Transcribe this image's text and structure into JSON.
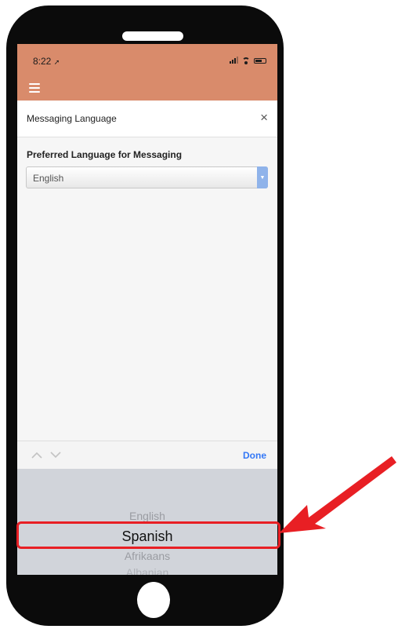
{
  "status_bar": {
    "time": "8:22",
    "location_icon": "location-arrow-icon",
    "icons": [
      "signal-icon",
      "wifi-icon",
      "battery-icon"
    ]
  },
  "app_bar": {
    "menu_icon": "hamburger-menu-icon"
  },
  "modal": {
    "title": "Messaging Language",
    "close_label": "×",
    "field_label": "Preferred Language for Messaging",
    "select_value": "English"
  },
  "picker": {
    "prev_label": "^",
    "next_label": "v",
    "done_label": "Done",
    "options": [
      "English",
      "Spanish",
      "Afrikaans",
      "Albanian"
    ],
    "selected": "Spanish"
  },
  "annotation": {
    "highlight_color": "#e81f24",
    "arrow_color": "#e81f24"
  },
  "colors": {
    "accent": "#d98b6b",
    "link": "#3478f6"
  }
}
